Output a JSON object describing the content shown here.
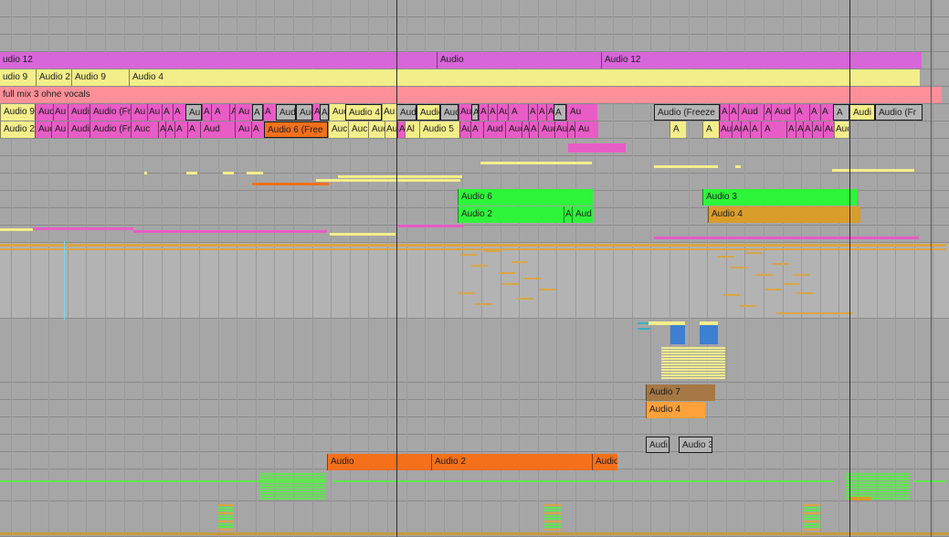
{
  "colors": {
    "background": "#a6a6a6",
    "violet": "#d766d9",
    "yellow": "#f4ee8a",
    "pink": "#ff909a",
    "magenta": "#e85cc6",
    "orange": "#f5701a",
    "green": "#2ef43a",
    "gold": "#d99d2a",
    "brown": "#a57845",
    "light_orange": "#ffa13b",
    "grey_clip": "#b5b5b5"
  },
  "tracks": {
    "track_1": {
      "clips": [
        "udio 12",
        "Audio",
        "Audio 12"
      ]
    },
    "track_2": {
      "clips": [
        "udio 9",
        "Audio 2",
        "Audio 9",
        "Audio 4"
      ]
    },
    "track_3": {
      "clips": [
        "full mix 3 ohne vocals"
      ]
    },
    "track_4": {
      "clips": [
        "Audio 9",
        "Aud",
        "Au",
        "Audi",
        "Audio (Fr",
        "Au",
        "Au",
        "A",
        "A",
        "Au",
        "A",
        "A",
        "Aud",
        "Au",
        "A",
        "A",
        "Aud",
        "Aud",
        "A",
        "Au",
        "Aud",
        "Audio 4",
        "Au",
        "Aud",
        "Audio",
        "Audi",
        "Au",
        "A",
        "A",
        "A",
        "Aud",
        "A",
        "A",
        "A",
        "A",
        "A",
        "Au",
        "Audio (Freeze",
        "A",
        "A",
        "Aud",
        "Au",
        "Aud",
        "A",
        "A",
        "A",
        "A",
        "Audi",
        "Audio (Fr"
      ]
    },
    "track_5": {
      "clips": [
        "Audio 2",
        "Auc",
        "Au",
        "Audi",
        "Audio (Fr",
        "Auc",
        "A",
        "A",
        "A",
        "A",
        "Aud",
        "Au",
        "A",
        "Audio 6 (Free",
        "Auc",
        "Auc",
        "Auc",
        "Au",
        "A",
        "Al",
        "Audio 5",
        "Au",
        "A",
        "Aud",
        "Auc",
        "A",
        "A",
        "Auc",
        "Au",
        "A",
        "Au",
        "A",
        "A",
        "Au",
        "Auc",
        "A",
        "A",
        "A",
        "A",
        "Auc",
        "A",
        "Ai",
        "Au",
        "Auc"
      ]
    },
    "track_9": {
      "clips": [
        "Audio 6",
        "Audio 3"
      ]
    },
    "track_10": {
      "clips": [
        "Audio 2",
        "Au",
        "Aud",
        "Audio 4"
      ]
    },
    "track_19": {
      "clips": [
        "Audio 7"
      ]
    },
    "track_20": {
      "clips": [
        "Audio 4"
      ]
    },
    "track_22": {
      "clips": [
        "Audi",
        "Audio 3"
      ]
    },
    "track_23": {
      "clips": [
        "Audio",
        "Audio 2",
        "Audio"
      ]
    }
  }
}
